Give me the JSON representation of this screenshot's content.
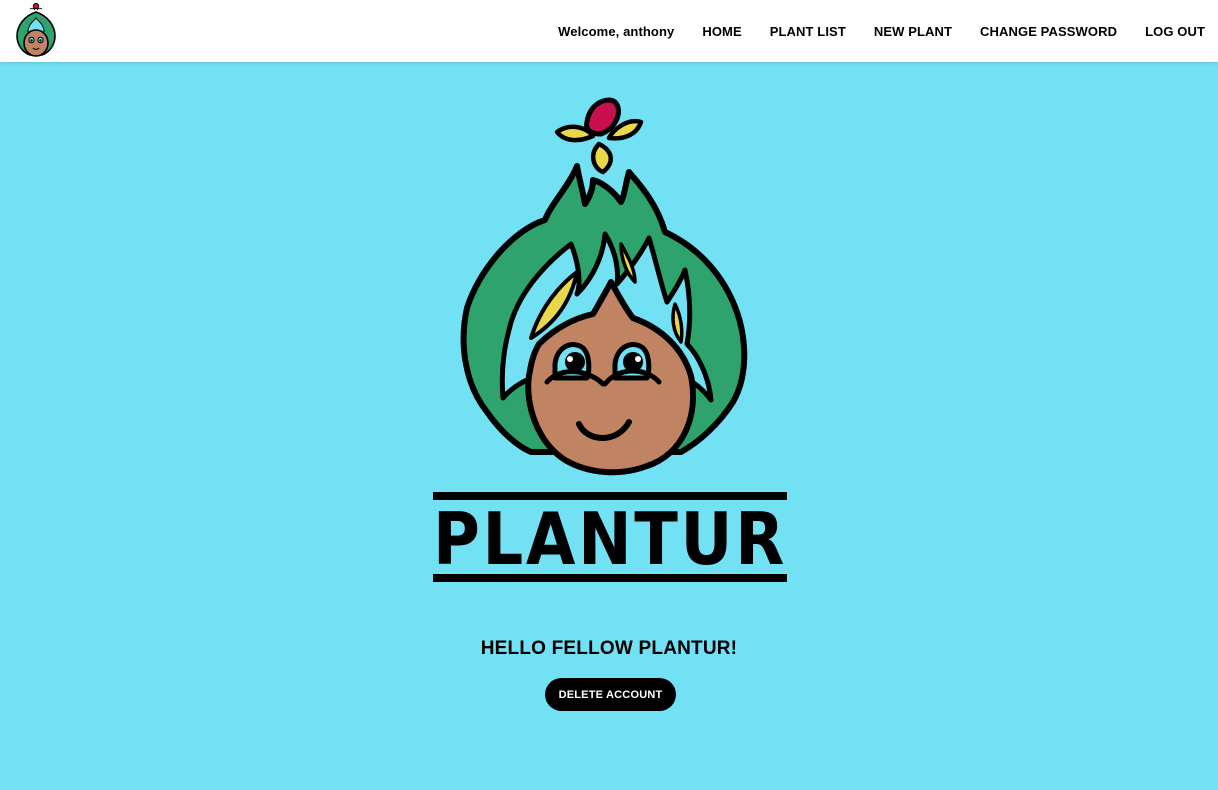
{
  "header": {
    "welcome_text": "Welcome, anthony",
    "nav": {
      "home": "HOME",
      "plant_list": "PLANT LIST",
      "new_plant": "NEW PLANT",
      "change_password": "CHANGE PASSWORD",
      "log_out": "LOG OUT"
    }
  },
  "main": {
    "logo_wordmark": "PLANTUR",
    "greeting": "HELLO FELLOW PLANTUR!",
    "delete_button": "DELETE ACCOUNT"
  },
  "colors": {
    "background": "#73e1f4",
    "leaf_green": "#2ea36e",
    "skin": "#c08462",
    "petal_yellow": "#e8d84a",
    "flower_pink": "#c8104e",
    "button": "#000000"
  }
}
